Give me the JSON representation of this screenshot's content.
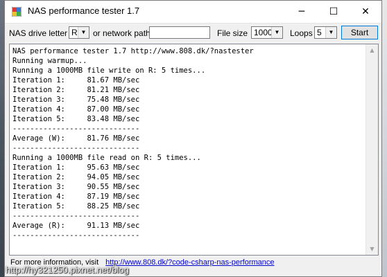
{
  "window": {
    "title": "NAS performance tester 1.7",
    "minimize_glyph": "─",
    "maximize_glyph": "☐",
    "close_glyph": "✕"
  },
  "toolbar": {
    "drive_label": "NAS drive letter",
    "drive_value": "R",
    "network_label": "or network path",
    "network_value": "",
    "filesize_label": "File size",
    "filesize_value": "1000",
    "loops_label": "Loops",
    "loops_value": "5",
    "start_label": "Start",
    "dropdown_glyph": "▼"
  },
  "output": {
    "lines": [
      "NAS performance tester 1.7 http://www.808.dk/?nastester",
      "Running warmup...",
      "Running a 1000MB file write on R: 5 times...",
      "Iteration 1:     81.67 MB/sec",
      "Iteration 2:     81.21 MB/sec",
      "Iteration 3:     75.48 MB/sec",
      "Iteration 4:     87.00 MB/sec",
      "Iteration 5:     83.48 MB/sec",
      "-----------------------------",
      "Average (W):     81.76 MB/sec",
      "-----------------------------",
      "Running a 1000MB file read on R: 5 times...",
      "Iteration 1:     95.63 MB/sec",
      "Iteration 2:     94.05 MB/sec",
      "Iteration 3:     90.55 MB/sec",
      "Iteration 4:     87.19 MB/sec",
      "Iteration 5:     88.25 MB/sec",
      "-----------------------------",
      "Average (R):     91.13 MB/sec",
      "-----------------------------"
    ],
    "scroll_up_glyph": "▲",
    "scroll_down_glyph": "▼"
  },
  "footer": {
    "info_text": "For more information, visit",
    "link_text": "http://www.808.dk/?code-csharp-nas-performance"
  },
  "watermark": "http://hy321250.pixnet.net/blog",
  "icons": [
    "app-icon",
    "minimize-icon",
    "maximize-icon",
    "close-icon",
    "dropdown-arrow-icon",
    "scroll-up-icon",
    "scroll-down-icon"
  ]
}
